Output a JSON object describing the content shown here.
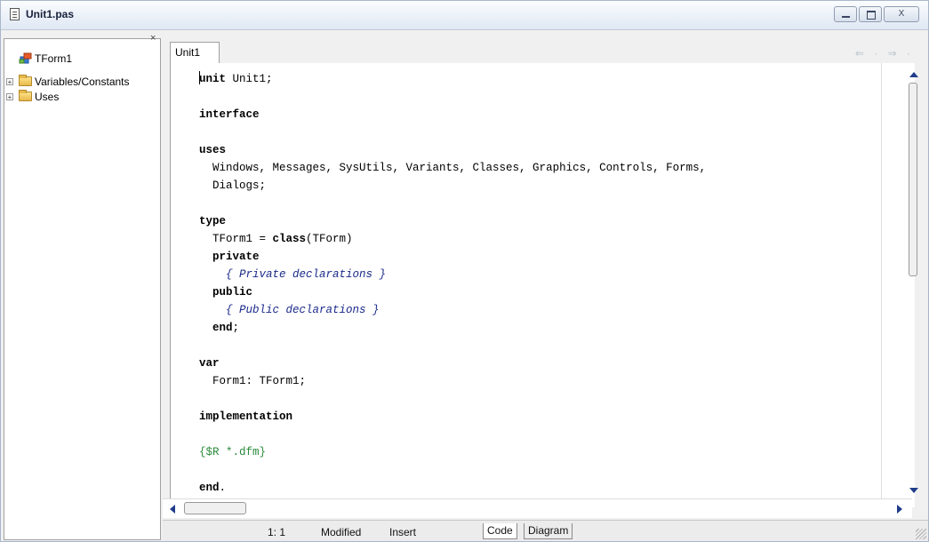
{
  "window": {
    "title": "Unit1.pas",
    "close_label": "X"
  },
  "tree": {
    "close_glyph": "×",
    "items": [
      {
        "label": "TForm1",
        "expander": ""
      },
      {
        "label": "Variables/Constants",
        "expander": "+"
      },
      {
        "label": "Uses",
        "expander": "+"
      }
    ]
  },
  "editor": {
    "tab_label": "Unit1",
    "nav_arrows": "⇐ · ⇒ ·",
    "lines": [
      "unit Unit1;",
      "",
      "interface",
      "",
      "uses",
      "  Windows, Messages, SysUtils, Variants, Classes, Graphics, Controls, Forms,",
      "  Dialogs;",
      "",
      "type",
      "  TForm1 = class(TForm)",
      "  private",
      "    { Private declarations }",
      "  public",
      "    { Public declarations }",
      "  end;",
      "",
      "var",
      "  Form1: TForm1;",
      "",
      "implementation",
      "",
      "{$R *.dfm}",
      "",
      "end."
    ]
  },
  "status": {
    "position": "1:  1",
    "modified": "Modified",
    "mode": "Insert",
    "tab_code": "Code",
    "tab_diagram": "Diagram"
  },
  "colors": {
    "comment": "#1a2a8a",
    "directive": "#2a8a3a",
    "scroll_arrow": "#1f3c8a"
  }
}
